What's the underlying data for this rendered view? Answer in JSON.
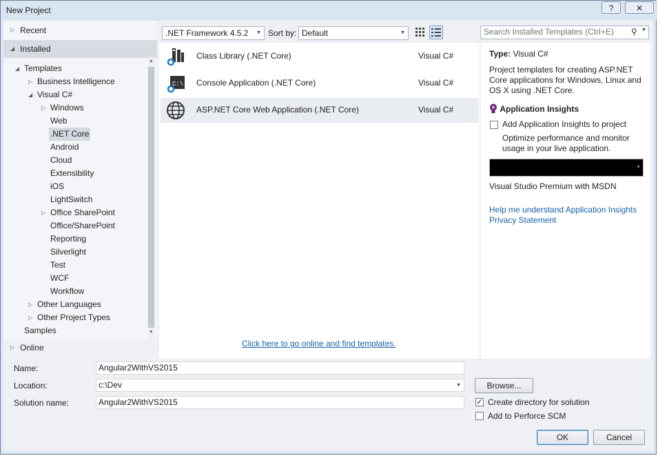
{
  "window": {
    "title": "New Project",
    "help_label": "?",
    "close_label": "✕"
  },
  "nav": {
    "recent": "Recent",
    "installed": "Installed",
    "online": "Online",
    "tree": [
      {
        "label": "Templates",
        "level": 0,
        "expander": "◢"
      },
      {
        "label": "Business Intelligence",
        "level": 1,
        "expander": "▷"
      },
      {
        "label": "Visual C#",
        "level": 1,
        "expander": "◢"
      },
      {
        "label": "Windows",
        "level": 2,
        "expander": "▷"
      },
      {
        "label": "Web",
        "level": 2
      },
      {
        "label": ".NET Core",
        "level": 2,
        "selected": true
      },
      {
        "label": "Android",
        "level": 2
      },
      {
        "label": "Cloud",
        "level": 2
      },
      {
        "label": "Extensibility",
        "level": 2
      },
      {
        "label": "iOS",
        "level": 2
      },
      {
        "label": "LightSwitch",
        "level": 2
      },
      {
        "label": "Office SharePoint",
        "level": 2,
        "expander": "▷"
      },
      {
        "label": "Office/SharePoint",
        "level": 2
      },
      {
        "label": "Reporting",
        "level": 2
      },
      {
        "label": "Silverlight",
        "level": 2
      },
      {
        "label": "Test",
        "level": 2
      },
      {
        "label": "WCF",
        "level": 2
      },
      {
        "label": "Workflow",
        "level": 2
      },
      {
        "label": "Other Languages",
        "level": 1,
        "expander": "▷"
      },
      {
        "label": "Other Project Types",
        "level": 1,
        "expander": "▷"
      },
      {
        "label": "Samples",
        "level": 0
      }
    ]
  },
  "toolbar": {
    "framework": ".NET Framework 4.5.2",
    "sort_label": "Sort by:",
    "sort_value": "Default",
    "search_placeholder": "Search Installed Templates (Ctrl+E)"
  },
  "templates": [
    {
      "name": "Class Library (.NET Core)",
      "lang": "Visual C#",
      "icon": "class-library-icon"
    },
    {
      "name": "Console Application (.NET Core)",
      "lang": "Visual C#",
      "icon": "console-app-icon"
    },
    {
      "name": "ASP.NET Core Web Application (.NET Core)",
      "lang": "Visual C#",
      "icon": "web-globe-icon",
      "selected": true
    }
  ],
  "online_link": "Click here to go online and find templates.",
  "details": {
    "type_label": "Type:",
    "type_value": "Visual C#",
    "description": "Project templates for creating ASP.NET Core applications for Windows, Linux and OS X using .NET Core.",
    "insights_heading": "Application Insights",
    "add_insights": "Add Application Insights to project",
    "add_insights_checked": false,
    "insights_description": "Optimize performance and monitor usage in your live application.",
    "account_text": "Visual Studio Premium with MSDN",
    "help_link": "Help me understand Application Insights",
    "privacy_link": "Privacy Statement"
  },
  "form": {
    "name_label": "Name:",
    "name_value": "Angular2WithVS2015",
    "location_label": "Location:",
    "location_value": "c:\\Dev",
    "solution_label": "Solution name:",
    "solution_value": "Angular2WithVS2015",
    "browse_label": "Browse...",
    "create_dir_label": "Create directory for solution",
    "create_dir_checked": true,
    "perforce_label": "Add to Perforce SCM",
    "perforce_checked": false,
    "ok_label": "OK",
    "cancel_label": "Cancel"
  },
  "colors": {
    "link": "#1660a8",
    "selection": "#d4d9e1",
    "chrome": "#dde7f3"
  }
}
